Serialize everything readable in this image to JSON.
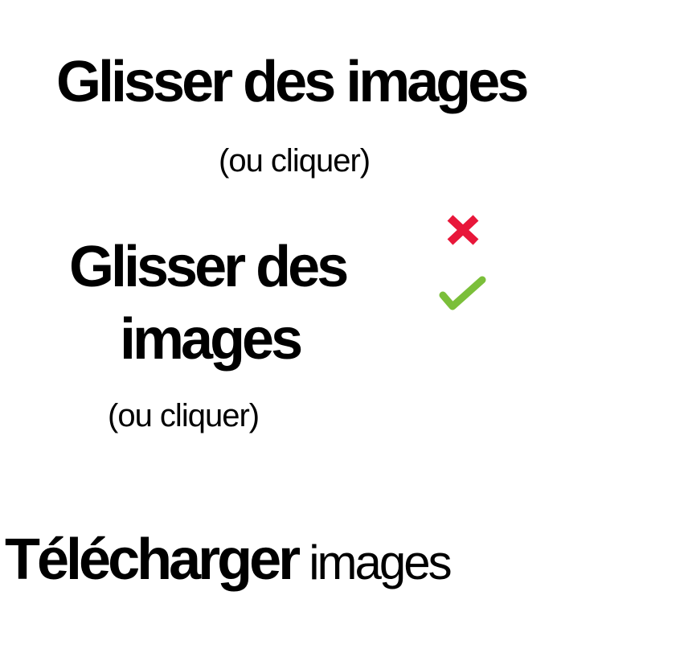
{
  "option_single_line": {
    "title": "Glisser des images",
    "subtitle": "(ou cliquer)",
    "status_icon": "cross-icon",
    "status_color": "#e8173a"
  },
  "option_two_lines": {
    "title_line1": "Glisser des",
    "title_line2": "images",
    "subtitle": "(ou cliquer)",
    "status_icon": "check-icon",
    "status_color": "#7bbf3a"
  },
  "upload_label": {
    "bold_word": "Télécharger",
    "light_word": "images"
  }
}
